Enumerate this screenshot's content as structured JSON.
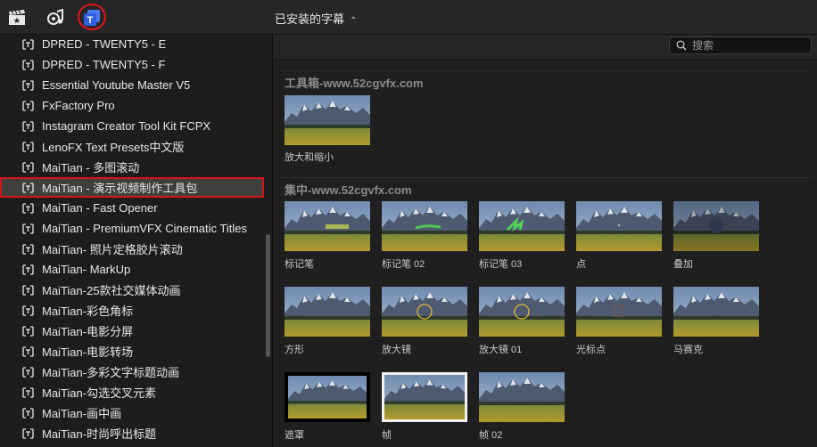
{
  "toolbar": {
    "icons": [
      "clapper-icon",
      "music-icon",
      "titles-icon"
    ],
    "browser_title": "已安装的字幕",
    "chevron": "⌃⌄"
  },
  "sidebar": {
    "items": [
      {
        "label": "DPRED - TWENTY5 - E"
      },
      {
        "label": "DPRED - TWENTY5 - F"
      },
      {
        "label": "Essential Youtube Master V5"
      },
      {
        "label": "FxFactory Pro"
      },
      {
        "label": "Instagram Creator Tool Kit FCPX"
      },
      {
        "label": "LenoFX Text Presets中文版"
      },
      {
        "label": "MaiTian - 多图滚动"
      },
      {
        "label": "MaiTian - 演示视频制作工具包",
        "selected": true
      },
      {
        "label": "MaiTian - Fast Opener"
      },
      {
        "label": "MaiTian - PremiumVFX Cinematic Titles"
      },
      {
        "label": "MaiTian- 照片定格胶片滚动"
      },
      {
        "label": "MaiTian- MarkUp"
      },
      {
        "label": "MaiTian-25款社交媒体动画"
      },
      {
        "label": "MaiTian-彩色角标"
      },
      {
        "label": "MaiTian-电影分屏"
      },
      {
        "label": "MaiTian-电影转场"
      },
      {
        "label": "MaiTian-多彩文字标题动画"
      },
      {
        "label": "MaiTian-勾选交叉元素"
      },
      {
        "label": "MaiTian-画中画"
      },
      {
        "label": "MaiTian-时尚呼出标题"
      }
    ]
  },
  "search": {
    "placeholder": "搜索",
    "value": ""
  },
  "groups": [
    {
      "title": "工具箱-www.52cgvfx.com",
      "items": [
        {
          "label": "放大和缩小",
          "overlay": "none"
        }
      ]
    },
    {
      "title": "集中-www.52cgvfx.com",
      "items": [
        {
          "label": "标记笔",
          "overlay": "marker-yellow"
        },
        {
          "label": "标记笔 02",
          "overlay": "marker-green-line"
        },
        {
          "label": "标记笔 03",
          "overlay": "marker-green-scribble"
        },
        {
          "label": "点",
          "overlay": "dot"
        },
        {
          "label": "叠加",
          "overlay": "overlay-circle"
        },
        {
          "label": "方形",
          "overlay": "none"
        },
        {
          "label": "放大镜",
          "overlay": "ring"
        },
        {
          "label": "放大镜 01",
          "overlay": "ring"
        },
        {
          "label": "光标点",
          "overlay": "square"
        },
        {
          "label": "马赛克",
          "overlay": "none"
        },
        {
          "label": "遮罩",
          "overlay": "frame-black"
        },
        {
          "label": "帧",
          "overlay": "frame-white"
        },
        {
          "label": "帧 02",
          "overlay": "none"
        }
      ]
    }
  ],
  "colors": {
    "highlight_red": "#d8131a",
    "accent_blue": "#2f5fe0"
  }
}
